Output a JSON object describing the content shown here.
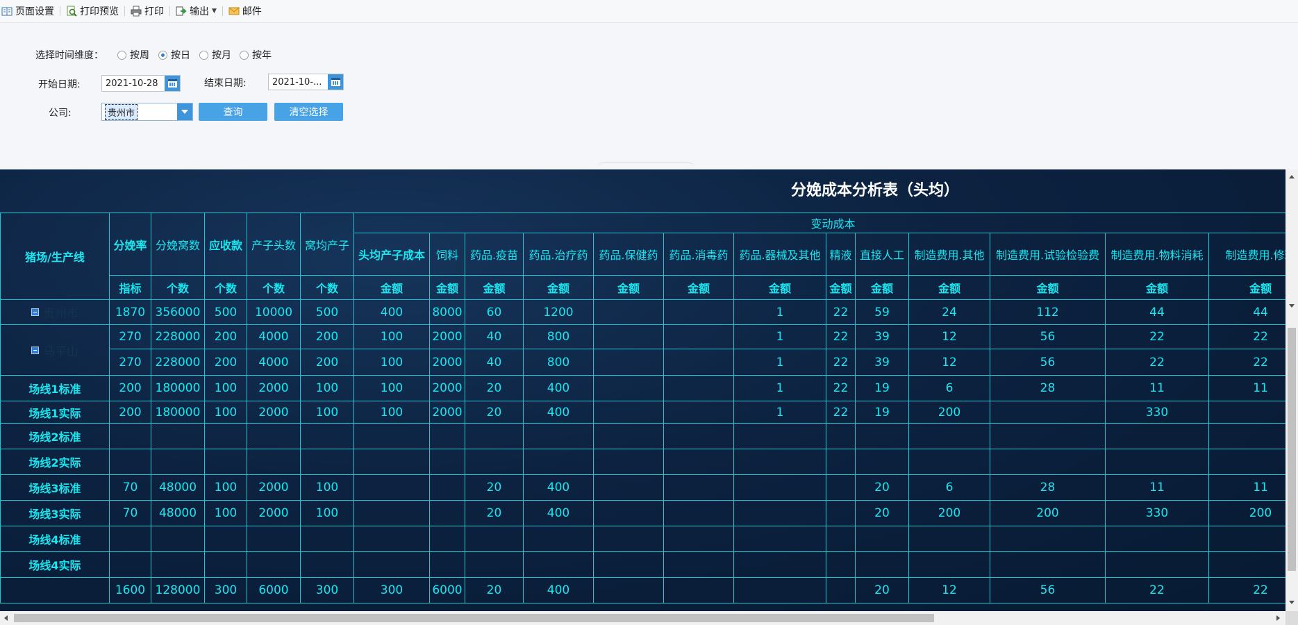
{
  "toolbar": {
    "page_setup": "页面设置",
    "print_preview": "打印预览",
    "print": "打印",
    "export": "输出",
    "mail": "邮件"
  },
  "filters": {
    "time_dim_label": "选择时间维度：",
    "options": [
      "按周",
      "按日",
      "按月",
      "按年"
    ],
    "selected": "按日",
    "start_label": "开始日期:",
    "start_value": "2021-10-28",
    "end_label": "结束日期:",
    "end_value": "2021-10-...",
    "company_label": "公司:",
    "company_value": "贵州市",
    "query_btn": "查询",
    "clear_btn": "清空选择"
  },
  "report": {
    "title": "分娩成本分析表（头均）",
    "group_header": "变动成本",
    "first_col_header": "猪场/生产线",
    "headers": [
      "分娩率",
      "分娩窝数",
      "应收款",
      "产子头数",
      "窝均产子",
      "头均产子成本",
      "饲料",
      "药品.疫苗",
      "药品.治疗药",
      "药品.保健药",
      "药品.消毒药",
      "药品.器械及其他",
      "精液",
      "直接人工",
      "制造费用.其他",
      "制造费用.试验检验费",
      "制造费用.物料消耗",
      "制造费用.修理"
    ],
    "units": [
      "指标",
      "个数",
      "个数",
      "个数",
      "个数",
      "金额",
      "金额",
      "金额",
      "金额",
      "金额",
      "金额",
      "金额",
      "金额",
      "金额",
      "金额",
      "金额",
      "金额",
      "金额"
    ],
    "rows": [
      {
        "label": "贵州市",
        "tree": true,
        "level": 1,
        "cells": [
          "1870",
          "356000",
          "500",
          "10000",
          "500",
          "400",
          "8000",
          "60",
          "1200",
          "",
          "",
          "1",
          "22",
          "59",
          "24",
          "112",
          "44",
          "44"
        ]
      },
      {
        "label": "马平山",
        "tree": true,
        "level": 2,
        "cells": [
          "270",
          "228000",
          "200",
          "4000",
          "200",
          "100",
          "2000",
          "40",
          "800",
          "",
          "",
          "1",
          "22",
          "39",
          "12",
          "56",
          "22",
          "22"
        ]
      },
      {
        "label": "",
        "tree": false,
        "cells": [
          "270",
          "228000",
          "200",
          "4000",
          "200",
          "100",
          "2000",
          "40",
          "800",
          "",
          "",
          "1",
          "22",
          "39",
          "12",
          "56",
          "22",
          "22"
        ]
      },
      {
        "label": "场线1标准",
        "tree": false,
        "cells": [
          "200",
          "180000",
          "100",
          "2000",
          "100",
          "100",
          "2000",
          "20",
          "400",
          "",
          "",
          "1",
          "22",
          "19",
          "6",
          "28",
          "11",
          "11"
        ]
      },
      {
        "label": "场线1实际",
        "tree": false,
        "cells": [
          "200",
          "180000",
          "100",
          "2000",
          "100",
          "100",
          "2000",
          "20",
          "400",
          "",
          "",
          "1",
          "22",
          "19",
          "200",
          "",
          "330",
          ""
        ]
      },
      {
        "label": "场线2标准",
        "tree": false,
        "cells": [
          "",
          "",
          "",
          "",
          "",
          "",
          "",
          "",
          "",
          "",
          "",
          "",
          "",
          "",
          "",
          "",
          "",
          ""
        ]
      },
      {
        "label": "场线2实际",
        "tree": false,
        "cells": [
          "",
          "",
          "",
          "",
          "",
          "",
          "",
          "",
          "",
          "",
          "",
          "",
          "",
          "",
          "",
          "",
          "",
          ""
        ]
      },
      {
        "label": "场线3标准",
        "tree": false,
        "cells": [
          "70",
          "48000",
          "100",
          "2000",
          "100",
          "",
          "",
          "20",
          "400",
          "",
          "",
          "",
          "",
          "20",
          "6",
          "28",
          "11",
          "11"
        ]
      },
      {
        "label": "场线3实际",
        "tree": false,
        "cells": [
          "70",
          "48000",
          "100",
          "2000",
          "100",
          "",
          "",
          "20",
          "400",
          "",
          "",
          "",
          "",
          "20",
          "200",
          "200",
          "330",
          "200"
        ]
      },
      {
        "label": "场线4标准",
        "tree": false,
        "cells": [
          "",
          "",
          "",
          "",
          "",
          "",
          "",
          "",
          "",
          "",
          "",
          "",
          "",
          "",
          "",
          "",
          "",
          ""
        ]
      },
      {
        "label": "场线4实际",
        "tree": false,
        "cells": [
          "",
          "",
          "",
          "",
          "",
          "",
          "",
          "",
          "",
          "",
          "",
          "",
          "",
          "",
          "",
          "",
          "",
          ""
        ]
      },
      {
        "label": "",
        "tree": false,
        "cells": [
          "1600",
          "128000",
          "300",
          "6000",
          "300",
          "300",
          "6000",
          "20",
          "400",
          "",
          "",
          "",
          "",
          "20",
          "12",
          "56",
          "22",
          "22"
        ]
      }
    ]
  }
}
